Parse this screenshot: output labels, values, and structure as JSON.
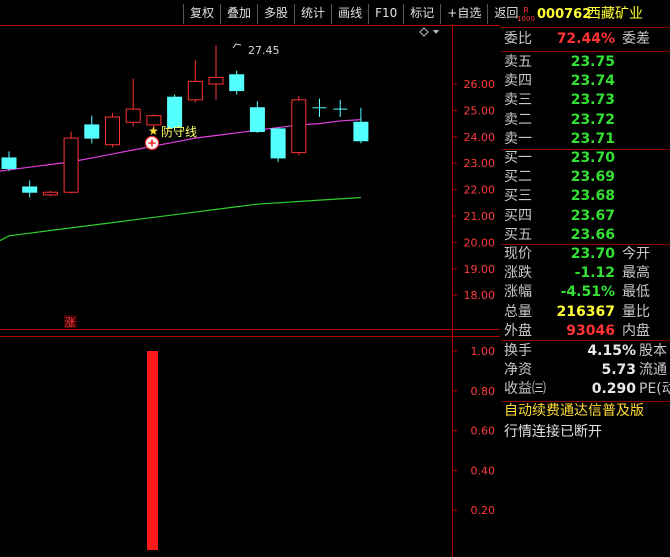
{
  "toolbar": {
    "items": [
      "复权",
      "叠加",
      "多股",
      "统计",
      "画线",
      "F10",
      "标记",
      "+自选",
      "返回"
    ]
  },
  "stock": {
    "badge_top": "R",
    "badge_bottom": "1000",
    "code": "000762",
    "name": "西藏矿业"
  },
  "main_chart": {
    "high_label": "27.45",
    "ma_label": "防守线",
    "price_ticks": [
      "26.00",
      "25.00",
      "24.00",
      "23.00",
      "22.00",
      "21.00",
      "20.00",
      "19.00",
      "18.00"
    ],
    "candles": [
      {
        "o": 23.2,
        "c": 22.8,
        "h": 23.45,
        "l": 22.7
      },
      {
        "o": 22.1,
        "c": 21.9,
        "h": 22.35,
        "l": 21.7
      },
      {
        "o": 21.8,
        "c": 21.9,
        "h": 21.95,
        "l": 21.75
      },
      {
        "o": 21.9,
        "c": 23.95,
        "h": 24.2,
        "l": 21.85
      },
      {
        "o": 24.45,
        "c": 23.95,
        "h": 24.8,
        "l": 23.75
      },
      {
        "o": 23.7,
        "c": 24.75,
        "h": 24.9,
        "l": 23.6
      },
      {
        "o": 24.55,
        "c": 25.05,
        "h": 26.2,
        "l": 24.4
      },
      {
        "o": 24.45,
        "c": 24.8,
        "h": 24.85,
        "l": 24.3
      },
      {
        "o": 25.5,
        "c": 24.35,
        "h": 25.6,
        "l": 24.25
      },
      {
        "o": 25.4,
        "c": 26.1,
        "h": 26.9,
        "l": 25.3
      },
      {
        "o": 26.0,
        "c": 26.25,
        "h": 27.45,
        "l": 25.4
      },
      {
        "o": 26.35,
        "c": 25.75,
        "h": 26.5,
        "l": 25.6
      },
      {
        "o": 25.1,
        "c": 24.2,
        "h": 25.35,
        "l": 24.15
      },
      {
        "o": 24.3,
        "c": 23.2,
        "h": 24.35,
        "l": 23.05
      },
      {
        "o": 23.4,
        "c": 25.4,
        "h": 25.55,
        "l": 23.3
      },
      {
        "o": 25.1,
        "c": 25.1,
        "h": 25.45,
        "l": 24.75
      },
      {
        "o": 25.05,
        "c": 25.05,
        "h": 25.4,
        "l": 24.75
      },
      {
        "o": 24.55,
        "c": 23.85,
        "h": 25.1,
        "l": 23.75
      }
    ],
    "ma_purple": [
      22.75,
      22.85,
      22.95,
      23.05,
      23.2,
      23.35,
      23.5,
      23.65,
      23.8,
      23.95,
      24.05,
      24.15,
      24.25,
      24.35,
      24.45,
      24.5,
      24.6,
      24.65
    ],
    "ma_green": [
      20.25,
      20.35,
      20.45,
      20.55,
      20.65,
      20.75,
      20.85,
      20.95,
      21.05,
      21.15,
      21.25,
      21.35,
      21.45,
      21.5,
      21.55,
      21.6,
      21.65,
      21.7
    ]
  },
  "sub_chart": {
    "marker": "涨",
    "ticks": [
      "1.00",
      "0.80",
      "0.60",
      "0.40",
      "0.20"
    ],
    "bar_value": 1.0
  },
  "quote": {
    "webi": {
      "label": "委比",
      "value": "72.44%",
      "label2": "委差"
    },
    "asks": [
      {
        "label": "卖五",
        "price": "23.75"
      },
      {
        "label": "卖四",
        "price": "23.74"
      },
      {
        "label": "卖三",
        "price": "23.73"
      },
      {
        "label": "卖二",
        "price": "23.72"
      },
      {
        "label": "卖一",
        "price": "23.71"
      }
    ],
    "bids": [
      {
        "label": "买一",
        "price": "23.70"
      },
      {
        "label": "买二",
        "price": "23.69"
      },
      {
        "label": "买三",
        "price": "23.68"
      },
      {
        "label": "买四",
        "price": "23.67"
      },
      {
        "label": "买五",
        "price": "23.66"
      }
    ],
    "stats": [
      {
        "label": "现价",
        "value": "23.70",
        "label2": "今开",
        "color": "green"
      },
      {
        "label": "涨跌",
        "value": "-1.12",
        "label2": "最高",
        "color": "green"
      },
      {
        "label": "涨幅",
        "value": "-4.51%",
        "label2": "最低",
        "color": "green"
      },
      {
        "label": "总量",
        "value": "216367",
        "label2": "量比",
        "color": "yellow"
      },
      {
        "label": "外盘",
        "value": "93046",
        "label2": "内盘",
        "color": "red"
      }
    ],
    "stats2": [
      {
        "label": "换手",
        "value": "4.15%",
        "label2": "股本"
      },
      {
        "label": "净资",
        "value": "5.73",
        "label2": "流通"
      },
      {
        "label": "收益㈢",
        "value": "0.290",
        "label2": "PE(动)"
      }
    ],
    "promo": "自动续费通达信普及版",
    "status": "行情连接已断开"
  },
  "colors": {
    "up": "#ff3232",
    "down": "#54ffff",
    "ma_purple": "#e040e0",
    "ma_green": "#2ecc2e",
    "axis": "#b40000",
    "tick_text": "#ff3c3c"
  }
}
